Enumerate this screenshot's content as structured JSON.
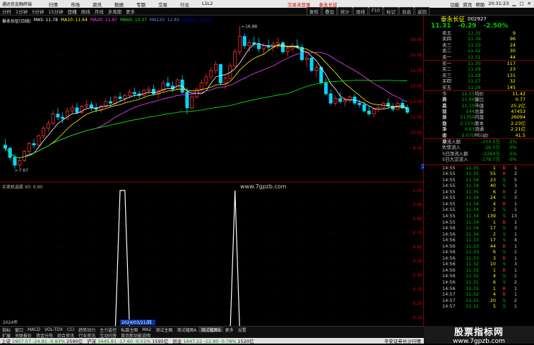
{
  "menubar": {
    "logo": "通达信金融终端",
    "items": [
      "行情",
      "市场",
      "资讯",
      "数据",
      "专题",
      "交易",
      "行业",
      "L1L2"
    ],
    "promo": [
      "交易未登录",
      "泰永长征"
    ],
    "right": [
      "功能",
      "资讯",
      "帮助"
    ],
    "time": "20:31:23"
  },
  "toolbar": {
    "periods": [
      "分时",
      "1分钟",
      "5分钟",
      "15分钟",
      "日线",
      "周线",
      "月线",
      "多周期",
      "更多"
    ],
    "active_period": "日线",
    "right": [
      "复权",
      "叠加",
      "统计",
      "画线",
      "F10",
      "标记",
      "自选",
      "返回"
    ]
  },
  "chart": {
    "stock_label": "泰永长征(日线)",
    "ma": [
      {
        "name": "MA5",
        "value": "11.78",
        "color": "#ffffff"
      },
      {
        "name": "MA10",
        "value": "11.64",
        "color": "#ffff00"
      },
      {
        "name": "MA20",
        "value": "11.87",
        "color": "#ff44ff"
      },
      {
        "name": "MA60",
        "value": "13.37",
        "color": "#00ff00"
      },
      {
        "name": "MA120",
        "value": "12.83",
        "color": "#6688ff"
      },
      {
        "name": "MA250",
        "value": "13.45",
        "color": "#0000cc"
      }
    ],
    "yticks": [
      "16.00",
      "15.00",
      "14.00",
      "13.00",
      "12.00",
      "11.00",
      "10.00",
      "9.00"
    ],
    "high_label": "16.88",
    "low_label": "7.67",
    "current_tag": "7.87",
    "watermark": "www.7gpzb.com",
    "indicator_label": "买卖机选股  X0: 0.00",
    "ind_yticks": [
      "1.00",
      "0.90",
      "0.80",
      "0.70",
      "0.60",
      "0.50",
      "0.40",
      "0.30",
      "0.20",
      "0.10"
    ],
    "date_left": "2024年",
    "date_cursor": "2024/03/21/四"
  },
  "chart_data": {
    "type": "candlestick",
    "ylim": [
      7.0,
      17.0
    ],
    "candles": [
      [
        9.2,
        9.6,
        8.8,
        9.0
      ],
      [
        9.0,
        9.1,
        8.2,
        8.4
      ],
      [
        8.4,
        8.6,
        7.67,
        7.9
      ],
      [
        7.9,
        8.3,
        7.7,
        8.2
      ],
      [
        8.2,
        8.9,
        8.1,
        8.8
      ],
      [
        8.8,
        9.4,
        8.6,
        9.3
      ],
      [
        9.3,
        9.6,
        9.0,
        9.2
      ],
      [
        9.2,
        9.9,
        9.1,
        9.8
      ],
      [
        9.8,
        10.4,
        9.6,
        10.3
      ],
      [
        10.3,
        10.8,
        10.1,
        10.6
      ],
      [
        10.6,
        11.4,
        10.5,
        11.2
      ],
      [
        11.2,
        11.6,
        10.8,
        11.0
      ],
      [
        11.0,
        11.3,
        10.6,
        10.9
      ],
      [
        10.9,
        11.6,
        10.8,
        11.4
      ],
      [
        11.4,
        11.8,
        11.2,
        11.6
      ],
      [
        11.6,
        11.9,
        11.2,
        11.3
      ],
      [
        11.3,
        11.8,
        11.2,
        11.7
      ],
      [
        11.7,
        12.1,
        11.5,
        11.8
      ],
      [
        11.8,
        12.0,
        11.4,
        11.6
      ],
      [
        11.6,
        11.9,
        11.3,
        11.5
      ],
      [
        11.5,
        11.8,
        11.3,
        11.7
      ],
      [
        11.7,
        12.2,
        11.6,
        12.0
      ],
      [
        12.0,
        12.3,
        11.7,
        11.9
      ],
      [
        11.9,
        12.4,
        11.8,
        12.3
      ],
      [
        12.3,
        12.6,
        12.0,
        12.2
      ],
      [
        12.2,
        12.5,
        11.9,
        12.4
      ],
      [
        12.4,
        12.8,
        12.2,
        12.6
      ],
      [
        12.6,
        12.9,
        12.3,
        12.5
      ],
      [
        12.5,
        12.7,
        12.2,
        12.4
      ],
      [
        12.4,
        12.8,
        12.3,
        12.7
      ],
      [
        12.7,
        13.0,
        12.5,
        12.8
      ],
      [
        12.8,
        13.1,
        12.4,
        12.5
      ],
      [
        12.5,
        12.8,
        12.2,
        12.7
      ],
      [
        12.7,
        13.4,
        12.6,
        13.2
      ],
      [
        13.2,
        13.6,
        12.9,
        13.0
      ],
      [
        13.0,
        13.3,
        12.6,
        12.8
      ],
      [
        12.8,
        13.5,
        12.7,
        13.4
      ],
      [
        13.4,
        13.7,
        12.5,
        12.6
      ],
      [
        12.6,
        12.9,
        11.2,
        11.6
      ],
      [
        11.6,
        12.4,
        11.5,
        12.3
      ],
      [
        12.3,
        12.9,
        12.2,
        12.8
      ],
      [
        12.8,
        13.4,
        12.7,
        13.2
      ],
      [
        13.2,
        13.8,
        13.0,
        13.6
      ],
      [
        13.6,
        14.2,
        13.4,
        14.0
      ],
      [
        14.0,
        14.6,
        13.8,
        14.4
      ],
      [
        14.4,
        14.2,
        13.0,
        13.2
      ],
      [
        13.2,
        13.7,
        12.8,
        13.5
      ],
      [
        13.5,
        14.5,
        13.4,
        14.3
      ],
      [
        14.3,
        15.4,
        14.2,
        15.2
      ],
      [
        15.2,
        16.88,
        15.0,
        16.2
      ],
      [
        16.2,
        16.4,
        15.4,
        15.6
      ],
      [
        15.6,
        16.0,
        15.2,
        15.8
      ],
      [
        15.8,
        16.2,
        15.5,
        15.7
      ],
      [
        15.7,
        16.1,
        15.2,
        15.4
      ],
      [
        15.4,
        15.8,
        15.0,
        15.6
      ],
      [
        15.6,
        16.0,
        15.3,
        15.5
      ],
      [
        15.5,
        15.9,
        15.2,
        15.7
      ],
      [
        15.7,
        16.1,
        15.4,
        15.8
      ],
      [
        15.8,
        15.9,
        15.1,
        15.2
      ],
      [
        15.2,
        15.6,
        14.9,
        15.4
      ],
      [
        15.4,
        15.8,
        15.2,
        15.6
      ],
      [
        15.6,
        16.0,
        15.4,
        15.5
      ],
      [
        15.5,
        15.7,
        14.6,
        14.7
      ],
      [
        14.7,
        15.0,
        14.2,
        14.8
      ],
      [
        14.8,
        14.9,
        13.9,
        14.0
      ],
      [
        14.0,
        14.4,
        13.6,
        14.2
      ],
      [
        14.2,
        14.3,
        13.1,
        13.2
      ],
      [
        13.2,
        13.5,
        12.4,
        12.5
      ],
      [
        12.5,
        12.8,
        11.8,
        11.9
      ],
      [
        11.9,
        12.4,
        11.7,
        12.2
      ],
      [
        12.2,
        12.6,
        11.9,
        12.0
      ],
      [
        12.0,
        12.3,
        11.7,
        12.1
      ],
      [
        12.1,
        12.4,
        11.9,
        12.3
      ],
      [
        12.3,
        12.5,
        11.8,
        11.9
      ],
      [
        11.9,
        12.1,
        11.6,
        11.8
      ],
      [
        11.8,
        12.0,
        11.3,
        11.4
      ],
      [
        11.4,
        11.7,
        11.1,
        11.2
      ],
      [
        11.2,
        11.6,
        11.0,
        11.5
      ],
      [
        11.5,
        11.8,
        11.3,
        11.6
      ],
      [
        11.6,
        12.0,
        11.5,
        11.9
      ],
      [
        11.9,
        12.2,
        11.6,
        11.7
      ],
      [
        11.7,
        11.9,
        11.4,
        11.5
      ],
      [
        11.5,
        12.0,
        11.4,
        11.9
      ],
      [
        11.9,
        12.1,
        11.5,
        11.6
      ],
      [
        11.6,
        11.8,
        11.2,
        11.31
      ]
    ],
    "spikes": [
      24,
      25,
      48
    ]
  },
  "quote": {
    "name": "泰永长征",
    "code": "002927",
    "price": "11.31",
    "change": "-0.29",
    "pct": "-2.50%",
    "asks": [
      {
        "label": "卖五",
        "price": "11.35",
        "vol": "9"
      },
      {
        "label": "卖四",
        "price": "11.34",
        "vol": "96"
      },
      {
        "label": "卖三",
        "price": "11.33",
        "vol": "24"
      },
      {
        "label": "卖二",
        "price": "11.32",
        "vol": "30"
      },
      {
        "label": "卖一",
        "price": "11.31",
        "vol": "44"
      }
    ],
    "bids": [
      {
        "label": "买一",
        "price": "11.30",
        "vol": "117"
      },
      {
        "label": "买二",
        "price": "11.29",
        "vol": "23"
      },
      {
        "label": "买三",
        "price": "11.28",
        "vol": "131"
      },
      {
        "label": "买四",
        "price": "11.27",
        "vol": "32"
      },
      {
        "label": "买五",
        "price": "11.26",
        "vol": "145"
      }
    ],
    "stats": [
      [
        "今开",
        "11.55",
        "均价",
        "11.42"
      ],
      [
        "最高",
        "11.68",
        "量比",
        "0.77"
      ],
      [
        "最低",
        "11.19",
        "市值",
        "25.2亿"
      ],
      [
        "现量",
        "544",
        "总量",
        "47453"
      ],
      [
        "外盘",
        "21359",
        "内盘",
        "26094"
      ],
      [
        "换手",
        "2.15%",
        "股本",
        "2.23亿"
      ],
      [
        "净资",
        "4.63",
        "流通",
        "2.21亿"
      ],
      [
        "收益(一)",
        "0.070",
        "PE(动)",
        "41.5"
      ]
    ],
    "flows": [
      [
        "净流入额",
        "-103.5万",
        "-2%"
      ],
      [
        "大宗流入",
        "-26.0万",
        "-0%"
      ],
      [
        "5日净流入额",
        "-2264万",
        "-5%"
      ],
      [
        "5日大宗流入",
        "-178.7万",
        "-0%"
      ]
    ]
  },
  "ticks": [
    [
      "14:55",
      "11.35",
      "1",
      "B",
      "1"
    ],
    [
      "14:55",
      "11.35",
      "55",
      "B",
      "2"
    ],
    [
      "14:55",
      "11.34",
      "23",
      "S",
      "5"
    ],
    [
      "14:55",
      "11.34",
      "40",
      "S",
      "3"
    ],
    [
      "14:55",
      "11.35",
      "6",
      "B",
      "2"
    ],
    [
      "14:55",
      "11.34",
      "24",
      "S",
      "3"
    ],
    [
      "14:55",
      "11.34",
      "4",
      "B",
      "1"
    ],
    [
      "14:55",
      "11.34",
      "2",
      "S",
      "1"
    ],
    [
      "14:55",
      "11.34",
      "139",
      "S",
      "13"
    ],
    [
      "14:55",
      "11.34",
      "1",
      "B",
      "1"
    ],
    [
      "14:56",
      "11.34",
      "17",
      "S",
      "3"
    ],
    [
      "14:56",
      "11.34",
      "2",
      "S",
      "1"
    ],
    [
      "14:56",
      "11.33",
      "17",
      "S",
      "4"
    ],
    [
      "14:56",
      "11.33",
      "44",
      "B",
      "1"
    ],
    [
      "14:56",
      "11.33",
      "6",
      "S",
      "1"
    ],
    [
      "14:56",
      "11.33",
      "3",
      "B",
      "1"
    ],
    [
      "14:56",
      "11.32",
      "10",
      "S",
      "3"
    ],
    [
      "14:56",
      "11.32",
      "1",
      "B",
      "1"
    ],
    [
      "14:56",
      "11.32",
      "4",
      "S",
      "1"
    ],
    [
      "14:56",
      "11.31",
      "6",
      "S",
      "2"
    ],
    [
      "14:56",
      "11.32",
      "1",
      "B",
      "1"
    ],
    [
      "14:57",
      "11.32",
      "4",
      "B",
      "1"
    ],
    [
      "14:57",
      "11.31",
      "20",
      "S",
      "2"
    ],
    [
      "14:57",
      "11.31",
      "5",
      "S",
      "1"
    ]
  ],
  "bottom_tabs": [
    "指标",
    "窗口",
    "MACD",
    "VOL-TDX",
    "CCI",
    "趋势动力",
    "主力监控",
    "私募主图",
    "MA2",
    "测试主图",
    "测试幅图A",
    "测试幅图B",
    "更多",
    "设置"
  ],
  "bottom_tabs_active": "测试幅图B",
  "bottom_row2": [
    "扩展",
    "关联报价",
    "资金分布",
    "综合资讯",
    "行业资讯",
    "互动问答",
    "首页新功能说明"
  ],
  "statusbar": [
    {
      "label": "上证",
      "value": "2957.57",
      "chg": "-24.81",
      "pct": "-0.83%",
      "amt": "2590亿"
    },
    {
      "label": "沪深",
      "value": "3445.81",
      "chg": "-17.60",
      "pct": "-0.51%",
      "amt": "1595亿"
    },
    {
      "label": "创业",
      "value": "1647.22",
      "chg": "-12.90",
      "pct": "-0.78%",
      "amt": "1520亿"
    }
  ],
  "status_right": "平安证券长沙行情",
  "brand": {
    "title": "股票指标网",
    "url": "www.7gpzb.com"
  }
}
